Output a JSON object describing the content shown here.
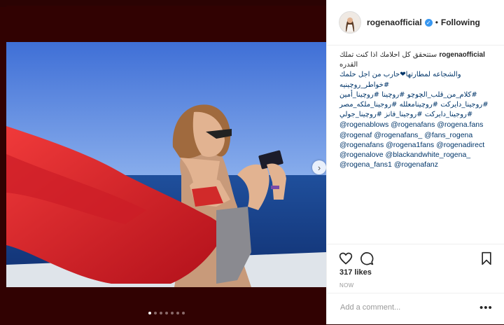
{
  "post": {
    "username": "rogenaofficial",
    "follow_separator": "•",
    "follow_label": "Following",
    "caption_user": "rogenaofficial",
    "caption_lines": [
      "ستتحقق كل احلامك اذا كنت تملك القدره",
      "والشجاعه لمطارتها❤حارب من اجل حلمك #خواطر_روچينيه",
      "#كلام_من_قلب_الچوچو #روچينا #روچينا_أمين",
      "#روجينا_دايركت #روچينامعلله #روجينا_ملكه_مصر",
      "#روجينا_دايركت #روجينا_فانز #روچينا_جولي"
    ],
    "mentions": [
      [
        "@rogenablows",
        "@rogenafans",
        "@rogena.fans"
      ],
      [
        "@rogenaf",
        "@rogenafans_",
        "@fans_rogena"
      ],
      [
        "@rogenafans",
        "@rogena1fans",
        "@rogenadirect"
      ],
      [
        "@rogenalove",
        "@blackandwhite_rogena_"
      ],
      [
        "@rogena_fans1",
        "@rogenafanz"
      ]
    ],
    "likes": "317 likes",
    "timestamp": "NOW",
    "comment_placeholder": "Add a comment...",
    "more_label": "•••"
  },
  "icons": {
    "verified": "verified-badge-icon",
    "like": "heart-icon",
    "comment": "comment-icon",
    "share": "share-icon",
    "save": "bookmark-icon",
    "next": "chevron-right-icon"
  },
  "carousel": {
    "dot_count": 7,
    "active_index": 0
  },
  "colors": {
    "accent": "#3897f0",
    "link": "#003569",
    "backdrop": "#310202",
    "dress": "#e0222c"
  }
}
